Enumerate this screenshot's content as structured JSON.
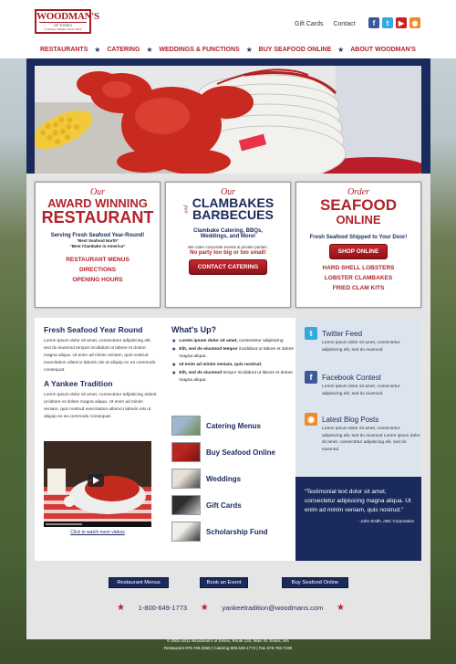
{
  "header": {
    "logo_name": "WOODMAN'S",
    "logo_sub": "OF ESSEX",
    "logo_tag": "A Yankee Tradition Since 1914",
    "gift_cards": "Gift Cards",
    "contact": "Contact",
    "social": [
      {
        "icon": "facebook-icon",
        "glyph": "f",
        "color": "#3b5998"
      },
      {
        "icon": "twitter-icon",
        "glyph": "t",
        "color": "#33aadd"
      },
      {
        "icon": "youtube-icon",
        "glyph": "▶",
        "color": "#cc2020"
      },
      {
        "icon": "rss-icon",
        "glyph": "◉",
        "color": "#f08a24"
      }
    ]
  },
  "nav": [
    "RESTAURANTS",
    "CATERING",
    "WEDDINGS & FUNCTIONS",
    "BUY SEAFOOD ONLINE",
    "ABOUT WOODMAN'S"
  ],
  "cards": {
    "restaurant": {
      "script": "Our",
      "line1": "AWARD WINNING",
      "line2": "RESTAURANT",
      "sub": "Serving Fresh Seafood Year-Round!",
      "quote1": "“Best Seafood North”",
      "quote2": "“Best Clambake in America”",
      "links": [
        "RESTAURANT MENUS",
        "DIRECTIONS",
        "OPENING HOURS"
      ]
    },
    "catering": {
      "script": "Our",
      "line1": "CLAMBAKES",
      "and": "and",
      "line2": "BARBECUES",
      "sub1": "Clambake Catering, BBQs,",
      "sub2": "Weddings, and More!",
      "corp": "We cater corporate events & private parties.",
      "party": "No party too big or too small!",
      "button": "CONTACT CATERING"
    },
    "order": {
      "script": "Order",
      "line1": "SEAFOOD",
      "line2": "ONLINE",
      "sub": "Fresh Seafood Shipped to Your Door!",
      "button": "SHOP ONLINE",
      "links": [
        "HARD SHELL LOBSTERS",
        "LOBSTER CLAMBAKES",
        "FRIED CLAM KITS"
      ]
    }
  },
  "col1": {
    "h1": "Fresh Seafood Year Round",
    "p1": "Lorem ipsum dolor sit amet, consectetur adipisicing elit, sed do eiusmod tempor incididunt ut labore et dolore magna aliqua. Ut enim ad minim veniam, quis nostrud exercitation ullamco laboris nisi ut aliquip ex ea commodo consequat.",
    "h2": "A Yankee Tradition",
    "p2": "Lorem ipsum dolor sit amet, consectetur adipisicing eidunt ut labore et dolore magna aliqua. Ut enim ad minim veniam, quis nostrud exercitation ullamco laboris nisi ut aliquip ex ea commodo consequat.",
    "video_link": "Click to watch more videos"
  },
  "whatsup": {
    "title": "What's Up?",
    "bullets": [
      {
        "bold": "Lorem ipsum dolor sit amet,",
        "rest": " consectetur adipisicing"
      },
      {
        "bold": "Elit, sed do eiusmod tempor",
        "rest": " incididunt ut labore et dolore magna aliqua."
      },
      {
        "bold": "Ut enim ad minim veniam, quis nostrud.",
        "rest": ""
      },
      {
        "bold": "Elit, sed do eiusmod",
        "rest": " tempor incididunt ut labore et dolore magna aliqua."
      }
    ],
    "links": [
      "Catering Menus",
      "Buy Seafood Online",
      "Weddings",
      "Gift Cards",
      "Scholarship Fund"
    ]
  },
  "feeds": [
    {
      "title": "Twitter Feed",
      "text": "Lorem ipsum dolor sit amet, consectetur adipisicing elit, sed do eiusmod",
      "icon": "twitter-icon",
      "glyph": "t",
      "color": "#33aadd"
    },
    {
      "title": "Facebook Contest",
      "text": "Lorem ipsum dolor sit amet, consectetur adipisicing elit, sed do eiusmod",
      "icon": "facebook-icon",
      "glyph": "f",
      "color": "#3b5998"
    },
    {
      "title": "Latest Blog Posts",
      "text": "Lorem ipsum dolor sit amet, consectetur adipisicing elit, sed do eiusmod Lorem ipsum dolor sit amet, consectetur adipisicing elit, sed do eiusmod",
      "icon": "rss-icon",
      "glyph": "◉",
      "color": "#f08a24"
    }
  ],
  "testimonial": {
    "quote": "“Testimonial text dolor sit amet, consectetur adipisicing magna aliqua. Ut enim ad minim veniam, quis nostrud.”",
    "by": "- John Smith, ABC Corporation"
  },
  "footer_buttons": [
    "Restaurant Menus",
    "Book an Event",
    "Buy Seafood Online"
  ],
  "contact": {
    "phone": "1-800-649-1773",
    "email": "yankeetradition@woodmans.com"
  },
  "footer": {
    "line1": "© 2001-2011 Woodman's of Essex, Route 133, Main St. Essex, MA",
    "line2": "Restaurant 978.768.2559 | Catering 800.649.1773 | Fax 978.768.7198"
  },
  "colors": {
    "brand_red": "#b2232b",
    "navy": "#1b2a5c"
  }
}
